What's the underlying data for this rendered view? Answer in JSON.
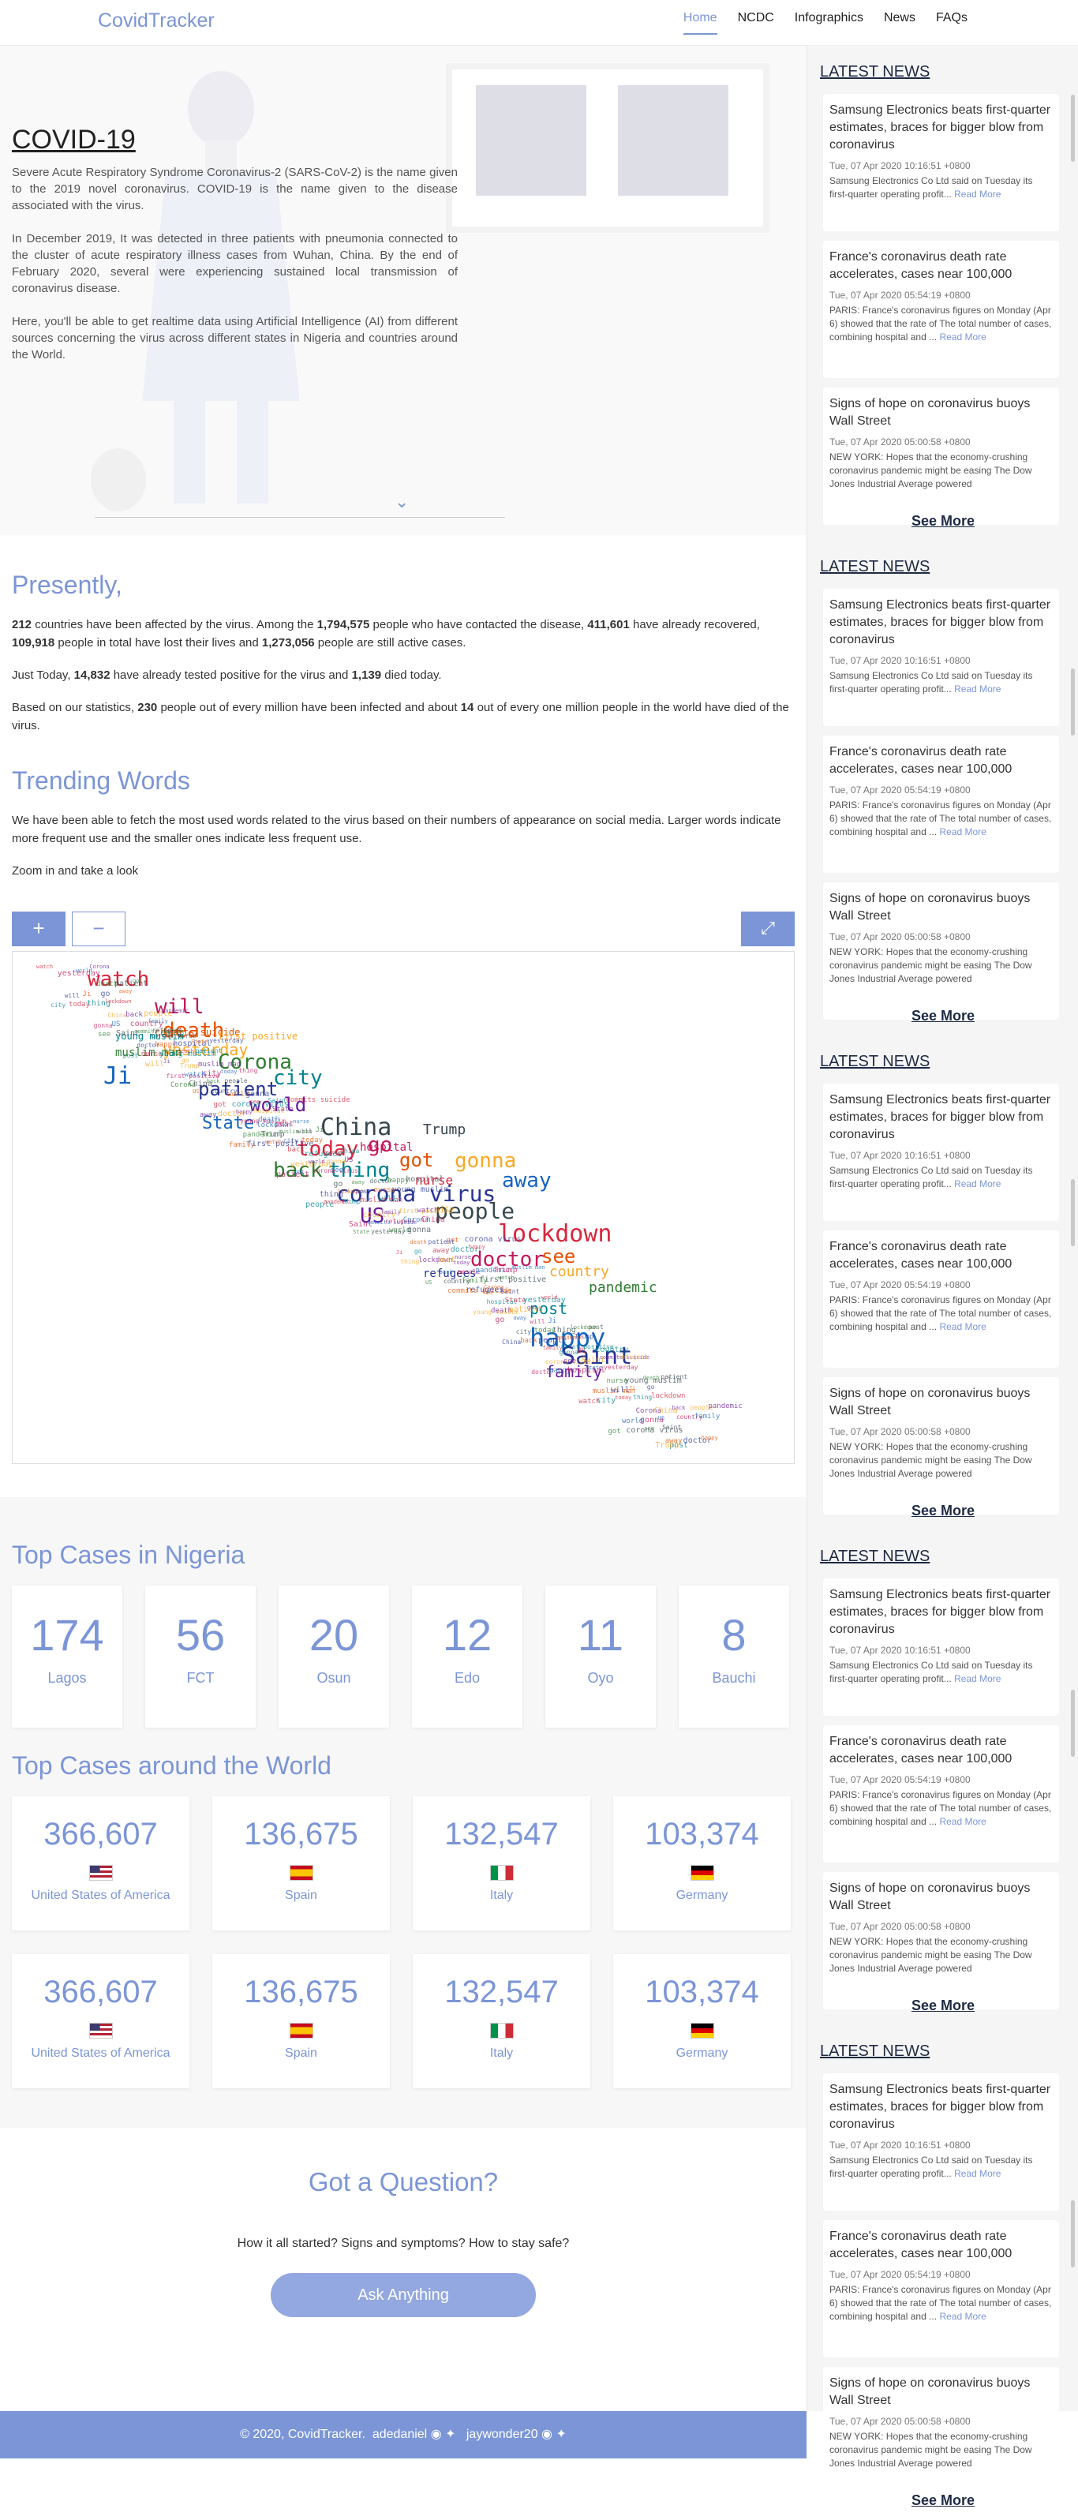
{
  "brand": "CovidTracker",
  "nav": [
    "Home",
    "NCDC",
    "Infographics",
    "News",
    "FAQs"
  ],
  "hero": {
    "title": "COVID-19",
    "p1": "Severe Acute Respiratory Syndrome Coronavirus-2 (SARS-CoV-2) is the name given to the 2019 novel coronavirus. COVID-19 is the name given to the disease associated with the virus.",
    "p2": "In December 2019, It was detected in three patients with pneumonia connected to the cluster of acute respiratory illness cases from Wuhan, China. By the end of February 2020, several were experiencing sustained local transmission of coronavirus disease.",
    "p3": "Here, you'll be able to get realtime data using Artificial Intelligence (AI) from different sources concerning the virus across different states in Nigeria and countries around the World."
  },
  "presently": {
    "title": "Presently,",
    "countries": "212",
    "contacted": "1,794,575",
    "recovered": "411,601",
    "lost": "109,918",
    "active": "1,273,056",
    "today_positive": "14,832",
    "today_died": "1,139",
    "per_million_infected": "230",
    "per_million_died": "14"
  },
  "trending": {
    "title": "Trending Words",
    "p1": "We have been able to fetch the most used words related to the virus based on their numbers of appearance on social media. Larger words indicate more frequent use and the smaller ones indicate less frequent use.",
    "p2": "Zoom in and take a look",
    "zoom_in": "+",
    "zoom_out": "−",
    "words": [
      "watch",
      "will",
      "death",
      "yesterday",
      "Corona",
      "city",
      "Ji",
      "patient",
      "world",
      "China",
      "today",
      "go",
      "got",
      "gonna",
      "back",
      "thing",
      "away",
      "corona virus",
      "US",
      "people",
      "lockdown",
      "doctor",
      "see",
      "country",
      "pandemic",
      "post",
      "happy",
      "Saint",
      "family",
      "Trump",
      "nurse",
      "hospital",
      "commits suicide",
      "first positive",
      "muslim man",
      "young muslim",
      "State",
      "refugees"
    ]
  },
  "nigeria": {
    "title": "Top Cases in Nigeria",
    "cards": [
      {
        "num": "174",
        "label": "Lagos"
      },
      {
        "num": "56",
        "label": "FCT"
      },
      {
        "num": "20",
        "label": "Osun"
      },
      {
        "num": "12",
        "label": "Edo"
      },
      {
        "num": "11",
        "label": "Oyo"
      },
      {
        "num": "8",
        "label": "Bauchi"
      }
    ]
  },
  "world": {
    "title": "Top Cases around the World",
    "cards": [
      {
        "num": "366,607",
        "label": "United States of America",
        "flag": "us-flag"
      },
      {
        "num": "136,675",
        "label": "Spain",
        "flag": "es-flag"
      },
      {
        "num": "132,547",
        "label": "Italy",
        "flag": "it-flag"
      },
      {
        "num": "103,374",
        "label": "Germany",
        "flag": "de-flag"
      }
    ]
  },
  "question": {
    "title": "Got a Question?",
    "text": "How it all started? Signs and symptoms? How to stay safe?",
    "button": "Ask Anything"
  },
  "footer": {
    "copy": "© 2020, CovidTracker.",
    "user1": "adedaniel",
    "user2": "jaywonder20"
  },
  "news": {
    "heading": "LATEST NEWS",
    "see_more": "See More",
    "read_more": "Read More",
    "items": [
      {
        "title": "Samsung Electronics beats first-quarter estimates, braces for bigger blow from coronavirus",
        "date": "Tue, 07 Apr 2020 10:16:51 +0800",
        "summary": "Samsung Electronics Co Ltd said on Tuesday its first-quarter operating profit..."
      },
      {
        "title": "France's coronavirus death rate accelerates, cases near 100,000",
        "date": "Tue, 07 Apr 2020 05:54:19 +0800",
        "summary": "PARIS: France's coronavirus figures on Monday (Apr 6) showed that the rate of The total number of cases, combining hospital and ..."
      },
      {
        "title": "Signs of hope on coronavirus buoys Wall Street",
        "date": "Tue, 07 Apr 2020 05:00:58 +0800",
        "summary": "NEW YORK: Hopes that the economy-crushing coronavirus pandemic might be easing The Dow Jones Industrial Average powered"
      }
    ]
  },
  "colors": {
    "accent": "#7b95d6",
    "footer": "#7b95d6",
    "button": "#93a7e0"
  }
}
